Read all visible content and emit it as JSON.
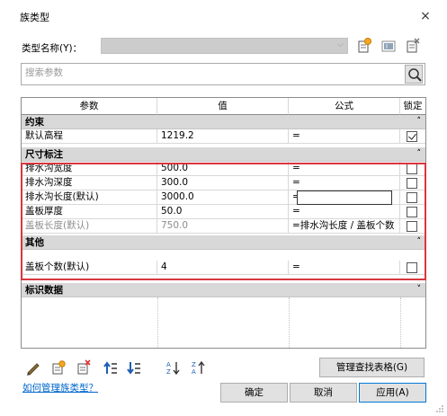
{
  "window": {
    "title": "族类型",
    "close_glyph": "×"
  },
  "type_name": {
    "label": "类型名称(Y)：",
    "value": ""
  },
  "toolbar": {
    "icons": [
      "new-type-icon",
      "rename-type-icon",
      "delete-type-icon"
    ]
  },
  "search": {
    "placeholder": "搜索参数",
    "icon": "search-icon"
  },
  "table": {
    "headers": [
      "参数",
      "值",
      "公式",
      "锁定"
    ],
    "groups": [
      {
        "name": "约束",
        "collapse_glyph": "˄",
        "rows": [
          {
            "param": "默认高程",
            "value": "1219.2",
            "formula": "=",
            "locked": true,
            "muted": false
          }
        ]
      },
      {
        "name": "尺寸标注",
        "collapse_glyph": "˄",
        "rows": [
          {
            "param": "排水沟宽度",
            "value": "500.0",
            "formula": "=",
            "locked": false,
            "muted": false
          },
          {
            "param": "排水沟深度",
            "value": "300.0",
            "formula": "=",
            "locked": false,
            "muted": false
          },
          {
            "param": "排水沟长度(默认)",
            "value": "3000.0",
            "formula": "=",
            "locked": false,
            "muted": false,
            "editing": true
          },
          {
            "param": "盖板厚度",
            "value": "50.0",
            "formula": "=",
            "locked": false,
            "muted": false
          },
          {
            "param": "盖板长度(默认)",
            "value": "750.0",
            "formula": "=排水沟长度 / 盖板个数",
            "locked": false,
            "muted": true
          }
        ]
      },
      {
        "name": "其他",
        "collapse_glyph": "˄",
        "rows": [
          {
            "param": "盖板个数(默认)",
            "value": "4",
            "formula": "=",
            "locked": false,
            "muted": false
          }
        ]
      },
      {
        "name": "标识数据",
        "collapse_glyph": "˅",
        "rows": []
      }
    ]
  },
  "bottom_toolbar": {
    "icons": [
      "edit-parameter-icon",
      "new-parameter-icon",
      "delete-parameter-icon",
      "move-up-icon",
      "move-down-icon",
      "sort-ascending-icon",
      "sort-descending-icon"
    ],
    "lookup_button": "管理查找表格(G)"
  },
  "help_link": "如何管理族类型？",
  "buttons": {
    "ok": "确定",
    "cancel": "取消",
    "apply": "应用(A)"
  },
  "colors": {
    "highlight_box": "#d9363e",
    "group_bg": "#d8d8d8",
    "link": "#0066cc",
    "accent": "#0078d7"
  }
}
